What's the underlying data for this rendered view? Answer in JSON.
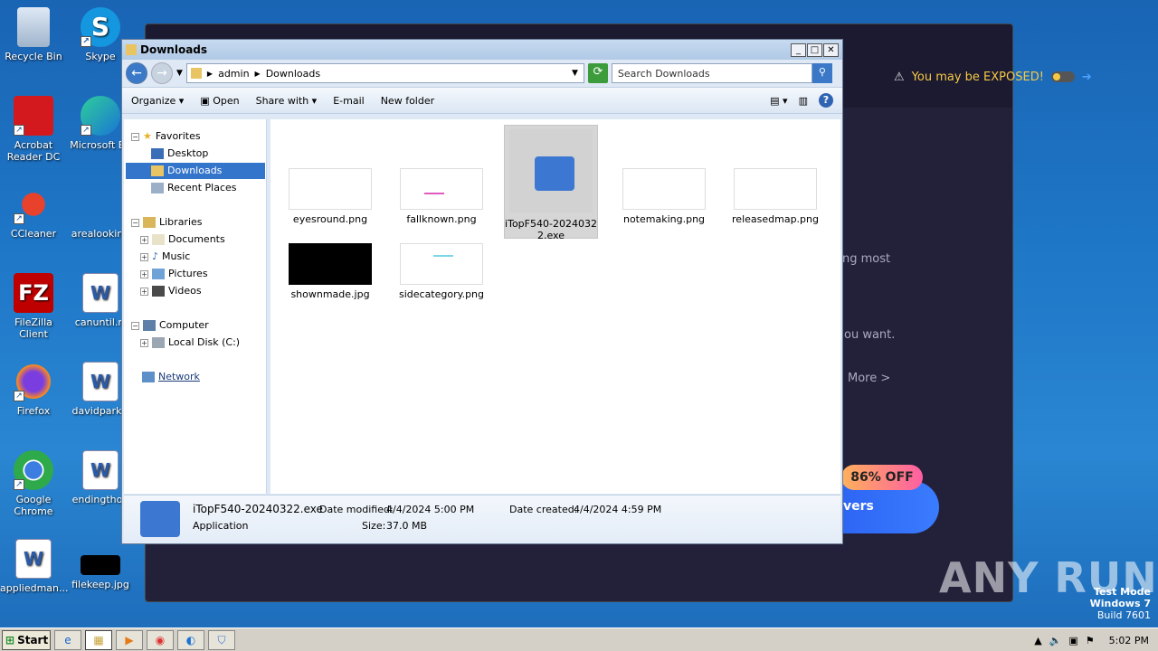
{
  "desktop": {
    "icons": [
      {
        "label": "Recycle Bin"
      },
      {
        "label": "Skype"
      },
      {
        "label": "Acrobat Reader DC"
      },
      {
        "label": "Microsoft Ed"
      },
      {
        "label": "CCleaner"
      },
      {
        "label": "arealooking"
      },
      {
        "label": "FileZilla Client"
      },
      {
        "label": "canuntil.rt"
      },
      {
        "label": "Firefox"
      },
      {
        "label": "davidpark.r"
      },
      {
        "label": "Google Chrome"
      },
      {
        "label": "endingthou"
      },
      {
        "label": "appliedman..."
      },
      {
        "label": "filekeep.jpg"
      }
    ]
  },
  "bg_app": {
    "exposed_text": "You may be EXPOSED!",
    "text1": "ng most",
    "text2": "ou want.",
    "more": "More >",
    "badge": "86% OFF",
    "promo": "vers"
  },
  "explorer": {
    "title": "Downloads",
    "breadcrumb": [
      "admin",
      "Downloads"
    ],
    "search_placeholder": "Search Downloads",
    "toolbar": {
      "organize": "Organize",
      "open": "Open",
      "share_with": "Share with",
      "email": "E-mail",
      "new_folder": "New folder"
    },
    "nav": {
      "favorites": "Favorites",
      "desktop": "Desktop",
      "downloads": "Downloads",
      "recent": "Recent Places",
      "libraries": "Libraries",
      "documents": "Documents",
      "music": "Music",
      "pictures": "Pictures",
      "videos": "Videos",
      "computer": "Computer",
      "local_disk": "Local Disk (C:)",
      "network": "Network"
    },
    "files": [
      {
        "name": "eyesround.png"
      },
      {
        "name": "fallknown.png"
      },
      {
        "name": "iTopF540-20240322.exe",
        "line1": "iTopF540-2024032",
        "line2": "2.exe"
      },
      {
        "name": "notemaking.png"
      },
      {
        "name": "releasedmap.png"
      },
      {
        "name": "shownmade.jpg"
      },
      {
        "name": "sidecategory.png"
      }
    ],
    "details": {
      "name": "iTopF540-20240322.exe",
      "type": "Application",
      "date_modified_label": "Date modified:",
      "date_modified": "4/4/2024 5:00 PM",
      "size_label": "Size:",
      "size": "37.0 MB",
      "date_created_label": "Date created:",
      "date_created": "4/4/2024 4:59 PM"
    }
  },
  "taskbar": {
    "start": "Start",
    "clock": "5:02 PM"
  },
  "watermark": {
    "line1": "Test Mode",
    "line2": "Windows 7",
    "line3": "Build 7601",
    "anyrun": "ANY RUN"
  }
}
